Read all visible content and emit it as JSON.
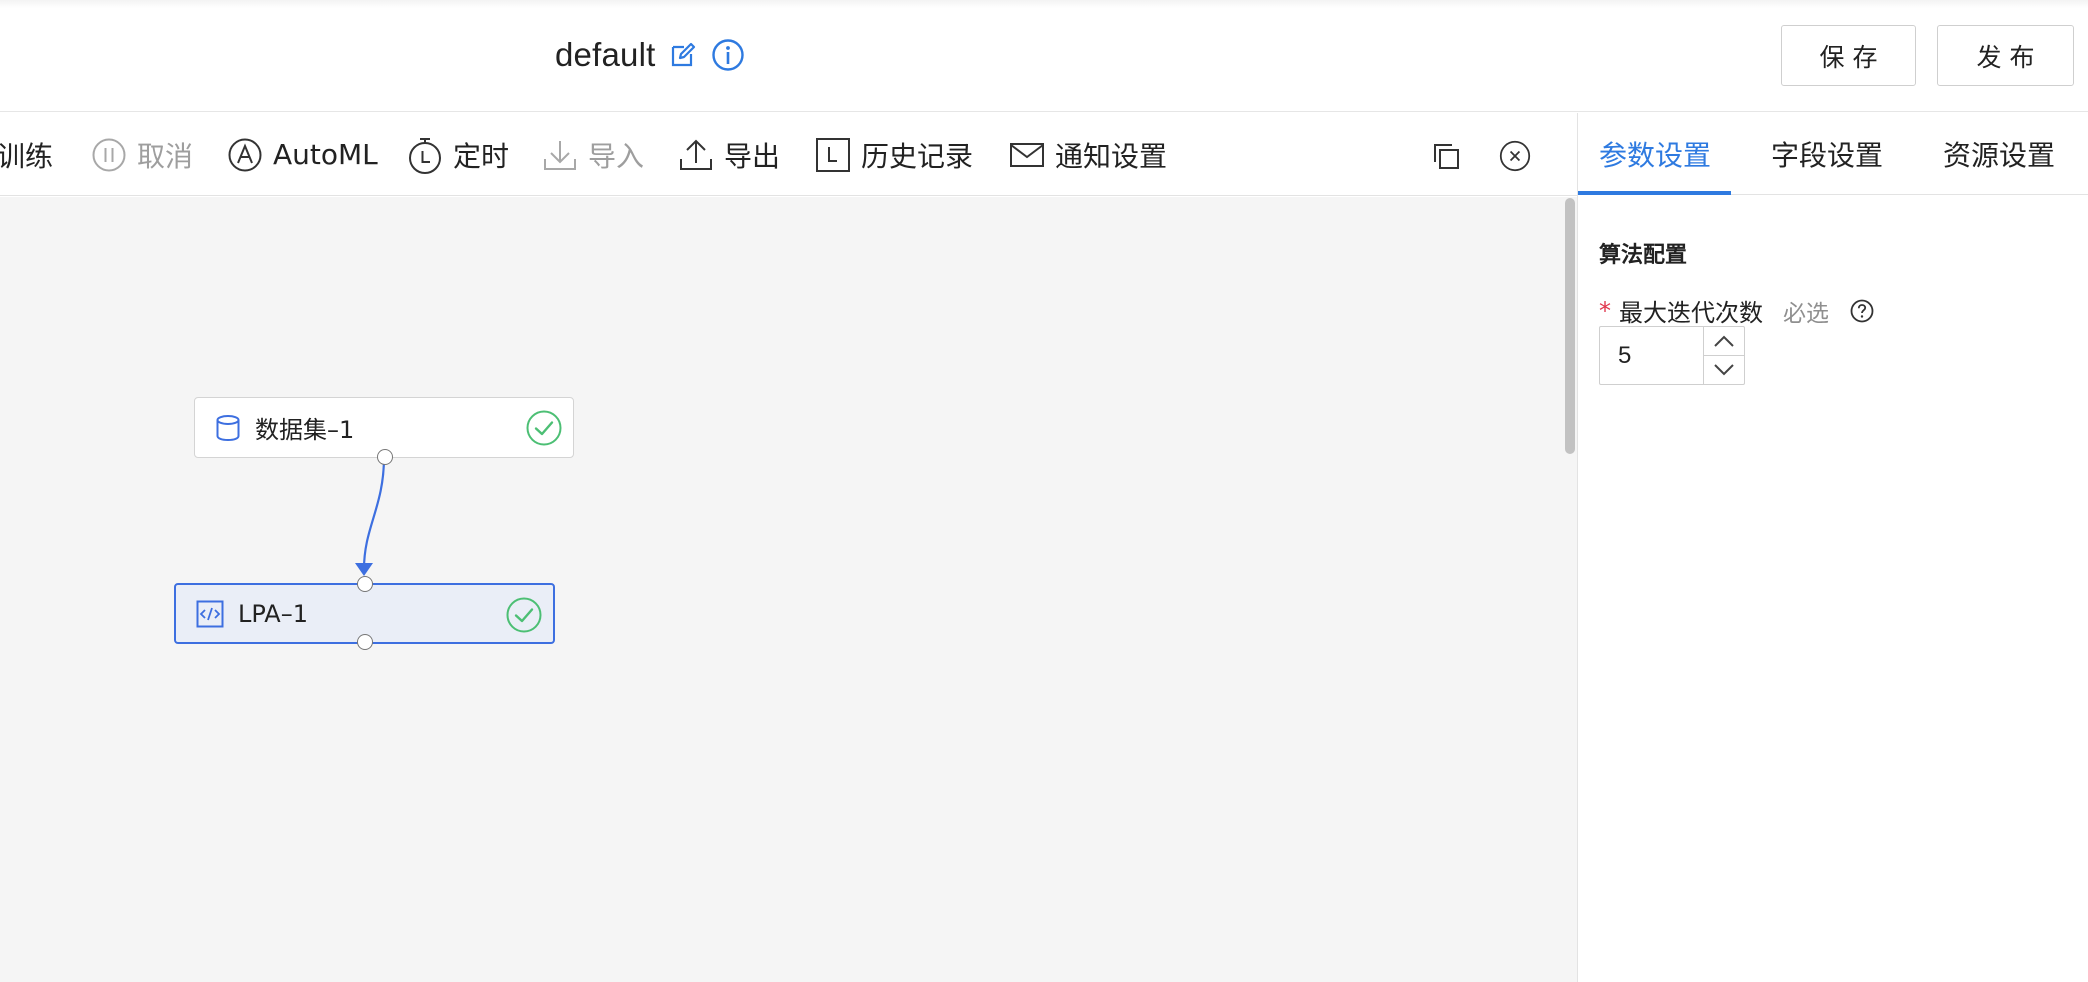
{
  "header": {
    "title": "default",
    "save_label": "保存",
    "publish_label": "发布"
  },
  "toolbar": {
    "items": [
      {
        "label": "训练",
        "icon": "train-icon",
        "disabled": false
      },
      {
        "label": "取消",
        "icon": "pause-circle-icon",
        "disabled": true
      },
      {
        "label": "AutoML",
        "icon": "automl-a-icon",
        "disabled": false
      },
      {
        "label": "定时",
        "icon": "timer-icon",
        "disabled": false
      },
      {
        "label": "导入",
        "icon": "import-icon",
        "disabled": true
      },
      {
        "label": "导出",
        "icon": "export-icon",
        "disabled": false
      },
      {
        "label": "历史记录",
        "icon": "history-icon",
        "disabled": false
      },
      {
        "label": "通知设置",
        "icon": "mail-icon",
        "disabled": false
      }
    ],
    "right_icons": [
      "copy-icon",
      "close-circle-icon"
    ]
  },
  "canvas": {
    "nodes": [
      {
        "label": "数据集–1",
        "icon": "database-icon",
        "status": "success-check-icon",
        "selected": false
      },
      {
        "label": "LPA–1",
        "icon": "code-icon",
        "status": "success-check-icon",
        "selected": true
      }
    ]
  },
  "panel": {
    "tabs": [
      "参数设置",
      "字段设置",
      "资源设置"
    ],
    "active_tab": "参数设置",
    "section_title": "算法配置",
    "field": {
      "required_mark": "*",
      "label": "最大迭代次数",
      "required_tag": "必选",
      "value": "5"
    }
  },
  "colors": {
    "accent": "#2e7ae0",
    "success": "#4cbf74",
    "required": "#e0364c",
    "canvas_bg": "#f5f5f5",
    "selected_node_bg": "#eaeef7"
  }
}
